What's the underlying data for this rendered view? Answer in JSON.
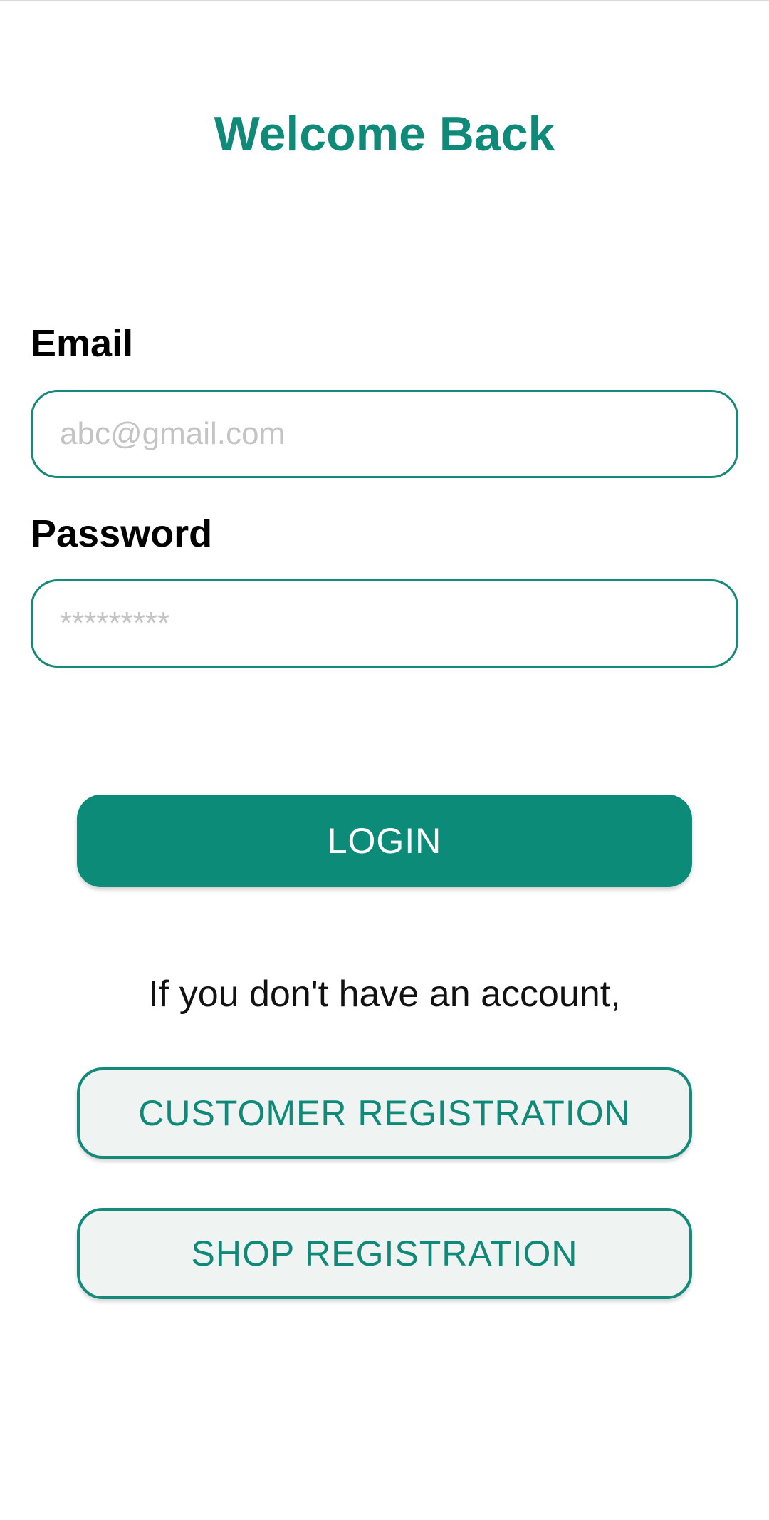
{
  "header": {
    "title": "Welcome Back"
  },
  "form": {
    "email_label": "Email",
    "email_placeholder": "abc@gmail.com",
    "email_value": "",
    "password_label": "Password",
    "password_placeholder": "*********",
    "password_value": ""
  },
  "actions": {
    "login_label": "LOGIN",
    "no_account_text": "If you don't have an account,",
    "customer_registration_label": "CUSTOMER REGISTRATION",
    "shop_registration_label": "SHOP REGISTRATION"
  },
  "colors": {
    "accent": "#0c8b78",
    "registration_button_bg": "#eff4f2",
    "placeholder": "#c4c4c4"
  }
}
